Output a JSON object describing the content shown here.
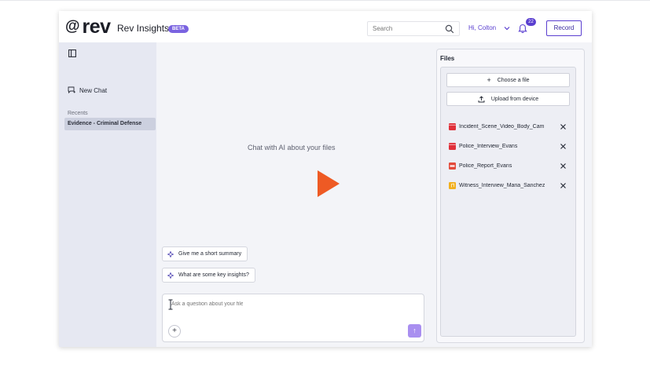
{
  "header": {
    "logo_text": "rev",
    "app_title": "Rev Insights",
    "beta_label": "BETA",
    "search_placeholder": "Search",
    "user_greeting": "Hi, Colton",
    "notification_count": "22",
    "record_label": "Record"
  },
  "sidebar": {
    "new_chat_label": "New Chat",
    "recents_label": "Recents",
    "recent_items": [
      "Evidence - Criminal Defense"
    ]
  },
  "chat": {
    "empty_state": "Chat with AI about your files",
    "suggestions": [
      "Give me a short summary",
      "What are some key insights?"
    ],
    "input_placeholder": "Ask a question about your files",
    "plus_label": "+",
    "send_label": "↑"
  },
  "files": {
    "title": "Files",
    "choose_label": "Choose a file",
    "upload_label": "Upload from device",
    "items": [
      {
        "name": "Incident_Scene_Video_Body_Cam",
        "type": "video",
        "color": "#e0303a"
      },
      {
        "name": "Police_Interview_Evans",
        "type": "video",
        "color": "#e0303a"
      },
      {
        "name": "Police_Report_Evans",
        "type": "pdf",
        "color": "#e34b3b"
      },
      {
        "name": "Witness_Interview_Maria_Sanchez",
        "type": "audio",
        "color": "#f2b01e"
      }
    ]
  },
  "colors": {
    "accent": "#5a3fd0",
    "play": "#ee5a24",
    "send": "#a98ff0"
  }
}
